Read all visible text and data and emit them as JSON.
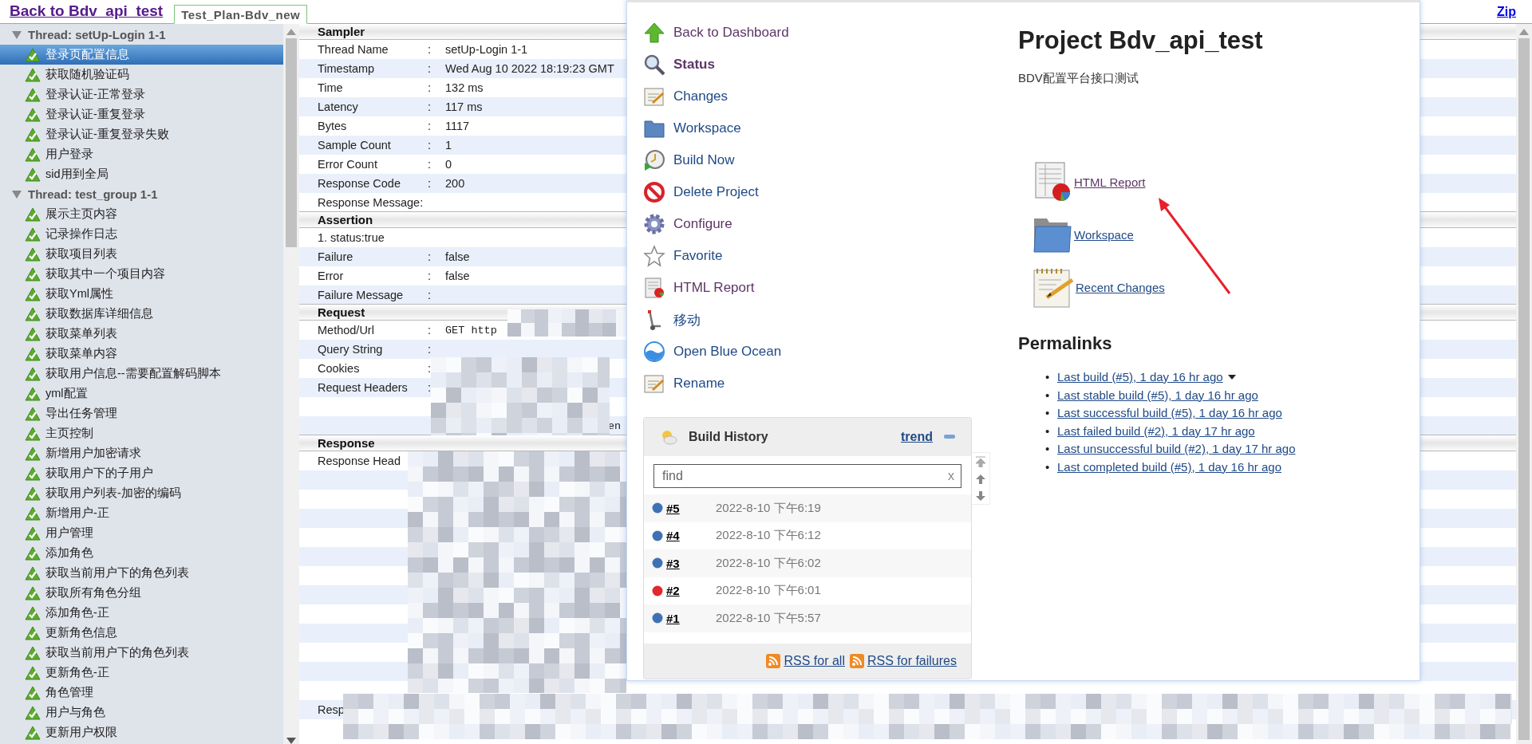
{
  "top_bar": {
    "back_link": "Back to Bdv_api_test",
    "tab": {
      "label": "Test_Plan-Bdv_new",
      "selected": true
    },
    "zip_link": "Zip"
  },
  "tree": [
    {
      "label": "Thread: setUp-Login 1-1",
      "expanded": true,
      "children": [
        {
          "label": "登录页配置信息",
          "selected": true
        },
        {
          "label": "获取随机验证码",
          "selected": false
        },
        {
          "label": "登录认证-正常登录",
          "selected": false
        },
        {
          "label": "登录认证-重复登录",
          "selected": false
        },
        {
          "label": "登录认证-重复登录失败",
          "selected": false
        },
        {
          "label": "用户登录",
          "selected": false
        },
        {
          "label": "sid用到全局",
          "selected": false
        }
      ]
    },
    {
      "label": "Thread: test_group 1-1",
      "expanded": true,
      "children": [
        {
          "label": "展示主页内容",
          "selected": false
        },
        {
          "label": "记录操作日志",
          "selected": false
        },
        {
          "label": "获取项目列表",
          "selected": false
        },
        {
          "label": "获取其中一个项目内容",
          "selected": false
        },
        {
          "label": "获取Yml属性",
          "selected": false
        },
        {
          "label": "获取数据库详细信息",
          "selected": false
        },
        {
          "label": "获取菜单列表",
          "selected": false
        },
        {
          "label": "获取菜单内容",
          "selected": false
        },
        {
          "label": "获取用户信息--需要配置解码脚本",
          "selected": false
        },
        {
          "label": "yml配置",
          "selected": false
        },
        {
          "label": "导出任务管理",
          "selected": false
        },
        {
          "label": "主页控制",
          "selected": false
        },
        {
          "label": "新增用户加密请求",
          "selected": false
        },
        {
          "label": "获取用户下的子用户",
          "selected": false
        },
        {
          "label": "获取用户列表-加密的编码",
          "selected": false
        },
        {
          "label": "新增用户-正",
          "selected": false
        },
        {
          "label": "用户管理",
          "selected": false
        },
        {
          "label": "添加角色",
          "selected": false
        },
        {
          "label": "获取当前用户下的角色列表",
          "selected": false
        },
        {
          "label": "获取所有角色分组",
          "selected": false
        },
        {
          "label": "添加角色-正",
          "selected": false
        },
        {
          "label": "更新角色信息",
          "selected": false
        },
        {
          "label": "获取当前用户下的角色列表",
          "selected": false
        },
        {
          "label": "更新角色-正",
          "selected": false
        },
        {
          "label": "角色管理",
          "selected": false
        },
        {
          "label": "用户与角色",
          "selected": false
        },
        {
          "label": "更新用户权限",
          "selected": false
        }
      ]
    }
  ],
  "details": {
    "sections": [
      {
        "title": "Sampler",
        "rows": [
          {
            "kind": "pair",
            "label": "Thread Name",
            "colon": ":",
            "value": "setUp-Login 1-1"
          },
          {
            "kind": "pair",
            "label": "Timestamp",
            "colon": ":",
            "value": "Wed Aug 10 2022 18:19:23 GMT"
          },
          {
            "kind": "pair",
            "label": "Time",
            "colon": ":",
            "value": "132 ms"
          },
          {
            "kind": "pair",
            "label": "Latency",
            "colon": ":",
            "value": "117 ms"
          },
          {
            "kind": "pair",
            "label": "Bytes",
            "colon": ":",
            "value": "1117"
          },
          {
            "kind": "pair",
            "label": "Sample Count",
            "colon": ":",
            "value": "1"
          },
          {
            "kind": "pair",
            "label": "Error Count",
            "colon": ":",
            "value": "0"
          },
          {
            "kind": "pair",
            "label": "Response Code",
            "colon": ":",
            "value": "200"
          },
          {
            "kind": "label",
            "label": "Response Message:"
          }
        ]
      },
      {
        "title": "Assertion",
        "rows": [
          {
            "kind": "note",
            "label": "1. status:true"
          },
          {
            "kind": "pair",
            "label": "Failure",
            "colon": ":",
            "value": "false"
          },
          {
            "kind": "pair",
            "label": "Error",
            "colon": ":",
            "value": "false"
          },
          {
            "kind": "pair",
            "label": "Failure Message",
            "colon": ":"
          }
        ]
      },
      {
        "title": "Request",
        "rows": [
          {
            "kind": "code",
            "label": "Method/Url",
            "colon": ":",
            "value": "GET http"
          },
          {
            "kind": "pair",
            "label": "Query String",
            "colon": ":"
          },
          {
            "kind": "pair",
            "label": "Cookies",
            "colon": ":"
          },
          {
            "kind": "pair",
            "label": "Request Headers",
            "colon": ":"
          },
          {
            "kind": "redacted"
          },
          {
            "kind": "redacted",
            "fragment": "en"
          }
        ]
      },
      {
        "title": "Response",
        "rows": [
          {
            "kind": "label",
            "label": "Response Head"
          },
          {
            "kind": "redacted"
          },
          {
            "kind": "redacted"
          },
          {
            "kind": "redacted"
          },
          {
            "kind": "redacted"
          },
          {
            "kind": "redacted"
          },
          {
            "kind": "redacted"
          },
          {
            "kind": "redacted"
          },
          {
            "kind": "redacted"
          },
          {
            "kind": "redacted"
          },
          {
            "kind": "redacted"
          },
          {
            "kind": "redacted"
          },
          {
            "kind": "redacted"
          },
          {
            "kind": "label",
            "label": "Resp"
          },
          {
            "kind": "redacted"
          }
        ]
      }
    ]
  },
  "jenkins": {
    "side_menu": [
      {
        "label": "Back to Dashboard",
        "visited": true,
        "current": false
      },
      {
        "label": "Status",
        "visited": true,
        "current": true
      },
      {
        "label": "Changes",
        "visited": false,
        "current": false
      },
      {
        "label": "Workspace",
        "visited": false,
        "current": false
      },
      {
        "label": "Build Now",
        "visited": false,
        "current": false
      },
      {
        "label": "Delete Project",
        "visited": false,
        "current": false
      },
      {
        "label": "Configure",
        "visited": true,
        "current": false
      },
      {
        "label": "Favorite",
        "visited": false,
        "current": false
      },
      {
        "label": "HTML Report",
        "visited": true,
        "current": false
      },
      {
        "label": "移动",
        "visited": false,
        "current": false
      },
      {
        "label": "Open Blue Ocean",
        "visited": false,
        "current": false
      },
      {
        "label": "Rename",
        "visited": false,
        "current": false
      }
    ],
    "build_history": {
      "title": "Build History",
      "trend_link": "trend",
      "search": {
        "placeholder": "find",
        "clear": "x"
      },
      "builds": [
        {
          "number": "#5",
          "date": "2022-8-10 下午6:19",
          "color": "#3f72b5"
        },
        {
          "number": "#4",
          "date": "2022-8-10 下午6:12",
          "color": "#3f72b5"
        },
        {
          "number": "#3",
          "date": "2022-8-10 下午6:02",
          "color": "#3f72b5"
        },
        {
          "number": "#2",
          "date": "2022-8-10 下午6:01",
          "color": "#e0282d"
        },
        {
          "number": "#1",
          "date": "2022-8-10 下午5:57",
          "color": "#3f72b5"
        }
      ],
      "rss_links": [
        "RSS for all",
        "RSS for failures"
      ]
    },
    "project": {
      "title": "Project Bdv_api_test",
      "description": "BDV配置平台接口测试",
      "links": [
        {
          "label": "HTML Report",
          "visited": true
        },
        {
          "label": "Workspace",
          "visited": false
        },
        {
          "label": "Recent Changes",
          "visited": false
        }
      ],
      "permalinks_title": "Permalinks",
      "permalinks": [
        {
          "marker": "•",
          "label": "Last build (#5), 1 day 16 hr ago",
          "menu": true
        },
        {
          "marker": "•",
          "label": "Last stable build (#5), 1 day 16 hr ago",
          "menu": false
        },
        {
          "marker": "•",
          "label": "Last successful build (#5), 1 day 16 hr ago",
          "menu": false
        },
        {
          "marker": "•",
          "label": "Last failed build (#2), 1 day 17 hr ago",
          "menu": false
        },
        {
          "marker": "•",
          "label": "Last unsuccessful build (#2), 1 day 17 hr ago",
          "menu": false
        },
        {
          "marker": "•",
          "label": "Last completed build (#5), 1 day 16 hr ago",
          "menu": false
        }
      ]
    }
  }
}
